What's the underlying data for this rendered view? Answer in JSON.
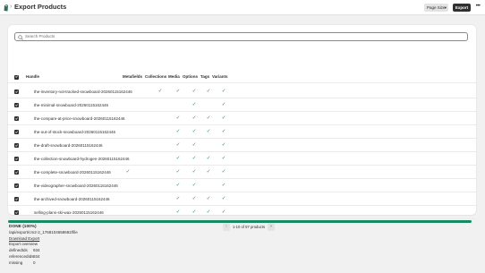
{
  "header": {
    "title": "Export Products",
    "breadcrumb_sep": "›",
    "page_size_label": "Page Size",
    "export_label": "Export",
    "more_label": "•••"
  },
  "search": {
    "placeholder": "Search Products"
  },
  "table": {
    "columns": {
      "handle": "Handle",
      "metafields": "Metafields",
      "collections": "Collections",
      "media": "Media",
      "options": "Options",
      "tags": "Tags",
      "variants": "Variants"
    },
    "check_glyph": "✓",
    "rows": [
      {
        "handle": "the-inventory-not-tracked-snowboard-20260115162446",
        "metafields": false,
        "collections": true,
        "media": true,
        "options": true,
        "tags": true,
        "variants": true
      },
      {
        "handle": "the-minimal-snowboard-20260115162446",
        "metafields": false,
        "collections": false,
        "media": false,
        "options": true,
        "tags": false,
        "variants": true
      },
      {
        "handle": "the-compare-at-price-snowboard-20260115162446",
        "metafields": false,
        "collections": false,
        "media": true,
        "options": true,
        "tags": true,
        "variants": true
      },
      {
        "handle": "the-out-of-stock-snowboard-20260115162446",
        "metafields": false,
        "collections": false,
        "media": true,
        "options": true,
        "tags": true,
        "variants": true
      },
      {
        "handle": "the-draft-snowboard-20260115162446",
        "metafields": false,
        "collections": false,
        "media": true,
        "options": true,
        "tags": false,
        "variants": true
      },
      {
        "handle": "the-collection-snowboard-hydrogen-20260115162446",
        "metafields": false,
        "collections": false,
        "media": true,
        "options": true,
        "tags": true,
        "variants": true
      },
      {
        "handle": "the-complete-snowboard-20260115162446",
        "metafields": true,
        "collections": false,
        "media": true,
        "options": true,
        "tags": true,
        "variants": true
      },
      {
        "handle": "the-videographer-snowboard-20260115162446",
        "metafields": false,
        "collections": false,
        "media": true,
        "options": true,
        "tags": false,
        "variants": true
      },
      {
        "handle": "the-archived-snowboard-20260115162446",
        "metafields": false,
        "collections": false,
        "media": true,
        "options": true,
        "tags": true,
        "variants": true
      },
      {
        "handle": "selling-plans-ski-wax-20260115162446",
        "metafields": false,
        "collections": false,
        "media": true,
        "options": true,
        "tags": true,
        "variants": true
      }
    ]
  },
  "pagination": {
    "label": "1-10 of 97 products",
    "prev": "‹",
    "next": "›"
  },
  "status": {
    "done_text": "DONE (100%)",
    "progress_percent": 100,
    "file_path": "/api/export/cm2-2_1768104658692/file",
    "download_label": "Download Export",
    "overview_label": "Export overview",
    "stats": [
      {
        "key": "definedIds",
        "value": "934"
      },
      {
        "key": "referencedIds",
        "value": "934"
      },
      {
        "key": "missing",
        "value": "0"
      }
    ]
  },
  "colors": {
    "accent_dark": "#303030",
    "success_green": "#29845a",
    "progress_green": "#158a65",
    "background": "#f1f1f1"
  },
  "icons": {
    "app": "shopify-bag-icon",
    "search": "search-icon",
    "checkbox": "checkbox-checked-icon",
    "check": "check-icon"
  }
}
